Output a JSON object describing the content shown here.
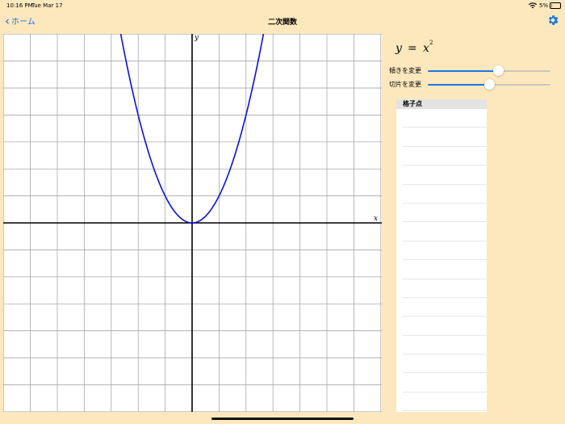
{
  "status_bar": {
    "time": "10:16 PM",
    "date": "Tue Mar 17",
    "battery_percent": "5%",
    "battery_level": 0.05
  },
  "nav": {
    "back_label": "ホーム",
    "title": "二次関数"
  },
  "graph": {
    "x_axis_label": "x",
    "y_axis_label": "y",
    "curve_color": "#0a12d6",
    "curve": "y = x^2"
  },
  "formula": {
    "y": "y",
    "eq": "=",
    "x": "x",
    "exp": "2"
  },
  "sliders": [
    {
      "label": "傾きを変更",
      "value": 0.57
    },
    {
      "label": "切片を変更",
      "value": 0.5
    }
  ],
  "table": {
    "header": "格子点",
    "rows": [
      "",
      "",
      "",
      "",
      "",
      "",
      "",
      "",
      "",
      "",
      "",
      "",
      "",
      "",
      "",
      ""
    ]
  },
  "colors": {
    "background": "#fde8bd",
    "accent": "#1a78e0"
  }
}
